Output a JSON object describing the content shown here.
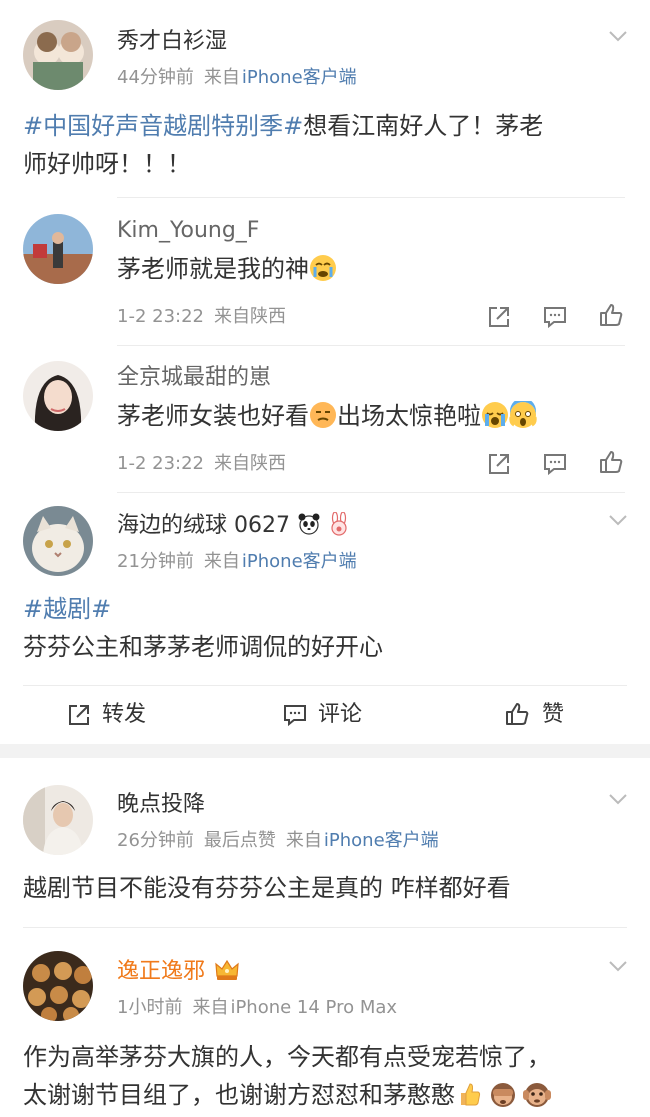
{
  "posts": [
    {
      "user": "秀才白衫湿",
      "time": "44分钟前",
      "source_prefix": "来自",
      "source": "iPhone客户端",
      "tag": "#中国好声音越剧特别季#",
      "text_line1": "想看江南好人了！茅老",
      "text_line2": "师好帅呀！！！"
    },
    {
      "user": "海边的绒球 0627",
      "time": "21分钟前",
      "source_prefix": "来自",
      "source": "iPhone客户端",
      "tag": "#越剧#",
      "text": "芬芬公主和茅茅老师调侃的好开心"
    },
    {
      "user": "晚点投降",
      "time": "26分钟前",
      "extra": "最后点赞",
      "source_prefix": "来自",
      "source": "iPhone客户端",
      "text": "越剧节目不能没有芬芬公主是真的 咋样都好看"
    },
    {
      "user": "逸正逸邪",
      "time": "1小时前",
      "source_prefix": "来自",
      "source": "iPhone 14 Pro Max",
      "text_line1": "作为高举茅芬大旗的人，今天都有点受宠若惊了，",
      "text_line2": "太谢谢节目组了，也谢谢方怼怼和茅憨憨"
    }
  ],
  "replies": [
    {
      "user": "Kim_Young_F",
      "text": "茅老师就是我的神",
      "time": "1-2 23:22",
      "location": "来自陕西",
      "emoji": "crying-face"
    },
    {
      "user": "全京城最甜的崽",
      "text_part1": "茅老师女装也好看",
      "text_part2": "出场太惊艳啦",
      "time": "1-2 23:22",
      "location": "来自陕西"
    }
  ],
  "actions": {
    "forward": "转发",
    "comment": "评论",
    "like": "赞"
  },
  "colors": {
    "link": "#507daf",
    "meta": "#939393",
    "vip_name": "#f07a1b",
    "divider": "#ececec",
    "icon": "#777777"
  },
  "icons": [
    "chevron-down-icon",
    "share-icon",
    "comment-icon",
    "thumbs-up-icon",
    "crown-icon",
    "panda-icon",
    "bunny-icon"
  ]
}
